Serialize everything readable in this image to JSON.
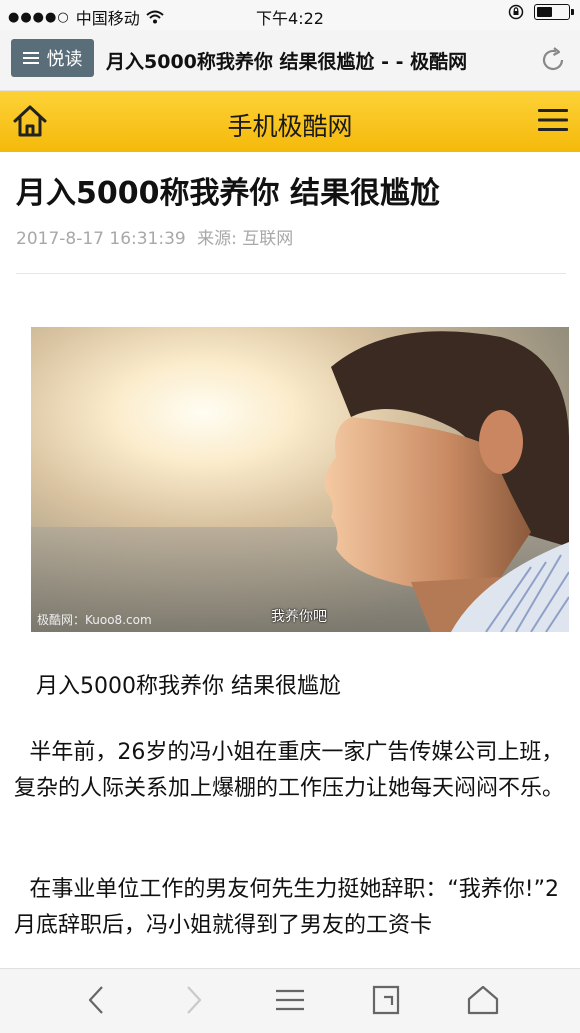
{
  "status_bar": {
    "signal_dots": "●●●●○",
    "carrier": "中国移动",
    "time": "下午4:22",
    "battery_level": 0.55
  },
  "browser": {
    "reader_label": "悦读",
    "tab_title": "月入5000称我养你 结果很尴尬 - - 极酷网"
  },
  "site": {
    "header_title": "手机极酷网",
    "accent_color": "#f8c320"
  },
  "article": {
    "title": "月入5000称我养你 结果很尴尬",
    "date": "2017-8-17 16:31:39",
    "source_label": "来源:",
    "source": "互联网",
    "image": {
      "watermark": "极酷网：Kuoo8.com",
      "caption": "我养你吧"
    },
    "paragraphs": [
      "月入5000称我养你 结果很尴尬",
      "半年前，26岁的冯小姐在重庆一家广告传媒公司上班，复杂的人际关系加上爆棚的工作压力让她每天闷闷不乐。",
      "在事业单位工作的男友何先生力挺她辞职：“我养你!”2月底辞职后，冯小姐就得到了男友的工资卡"
    ]
  },
  "toolbar": {
    "icons": [
      "back-icon",
      "forward-icon",
      "menu-icon",
      "tabs-icon",
      "home-icon"
    ]
  }
}
